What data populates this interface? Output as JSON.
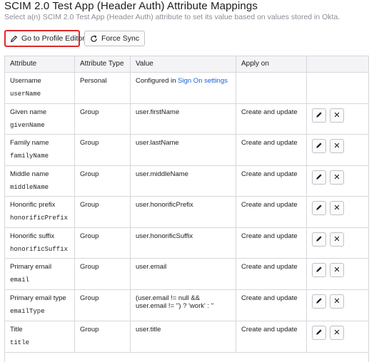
{
  "header": {
    "title": "SCIM 2.0 Test App (Header Auth) Attribute Mappings",
    "subtitle": "Select a(n) SCIM 2.0 Test App (Header Auth) attribute to set its value based on values stored in Okta."
  },
  "toolbar": {
    "profile_editor_label": "Go to Profile Editor",
    "force_sync_label": "Force Sync"
  },
  "table": {
    "columns": [
      "Attribute",
      "Attribute Type",
      "Value",
      "Apply on",
      ""
    ],
    "rows": [
      {
        "label": "Username",
        "var": "userName",
        "type": "Personal",
        "value_prefix": "Configured in ",
        "value_link": "Sign On settings",
        "apply_on": ""
      },
      {
        "label": "Given name",
        "var": "givenName",
        "type": "Group",
        "value": "user.firstName",
        "apply_on": "Create and update"
      },
      {
        "label": "Family name",
        "var": "familyName",
        "type": "Group",
        "value": "user.lastName",
        "apply_on": "Create and update"
      },
      {
        "label": "Middle name",
        "var": "middleName",
        "type": "Group",
        "value": "user.middleName",
        "apply_on": "Create and update"
      },
      {
        "label": "Honorific prefix",
        "var": "honorificPrefix",
        "type": "Group",
        "value": "user.honorificPrefix",
        "apply_on": "Create and update"
      },
      {
        "label": "Honorific suffix",
        "var": "honorificSuffix",
        "type": "Group",
        "value": "user.honorificSuffix",
        "apply_on": "Create and update"
      },
      {
        "label": "Primary email",
        "var": "email",
        "type": "Group",
        "value": "user.email",
        "apply_on": "Create and update"
      },
      {
        "label": "Primary email type",
        "var": "emailType",
        "type": "Group",
        "value": "(user.email != null && user.email != '') ? 'work' : ''",
        "apply_on": "Create and update"
      },
      {
        "label": "Title",
        "var": "title",
        "type": "Group",
        "value": "user.title",
        "apply_on": "Create and update"
      }
    ]
  },
  "icons": {
    "edit": "pencil-icon",
    "remove": "close-icon",
    "profile_editor": "pencil-icon",
    "force_sync": "refresh-icon"
  },
  "colors": {
    "link": "#1662dd",
    "highlight_border": "#e0282b",
    "header_bg": "#f4f4f6"
  }
}
